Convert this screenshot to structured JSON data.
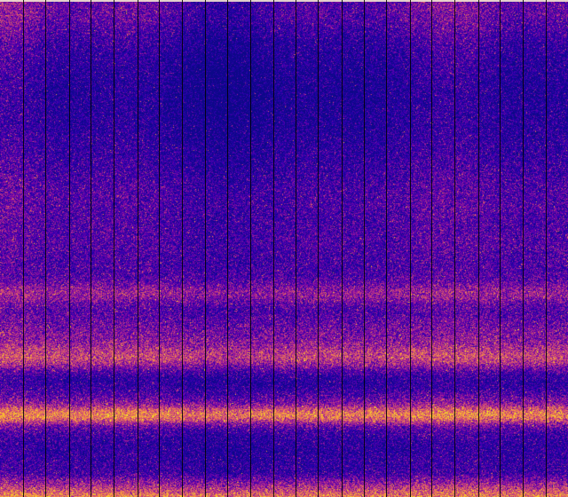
{
  "image": {
    "kind": "spectrogram-like noise field",
    "colormap": "plasma",
    "colormap_stops": [
      "#0d0887",
      "#2a00b0",
      "#6a00a8",
      "#b12a90",
      "#e16462",
      "#fca636",
      "#f0f921"
    ],
    "divider_color": "#000000",
    "top_edge_color": "#f2e4d0",
    "segment_count": 25
  }
}
